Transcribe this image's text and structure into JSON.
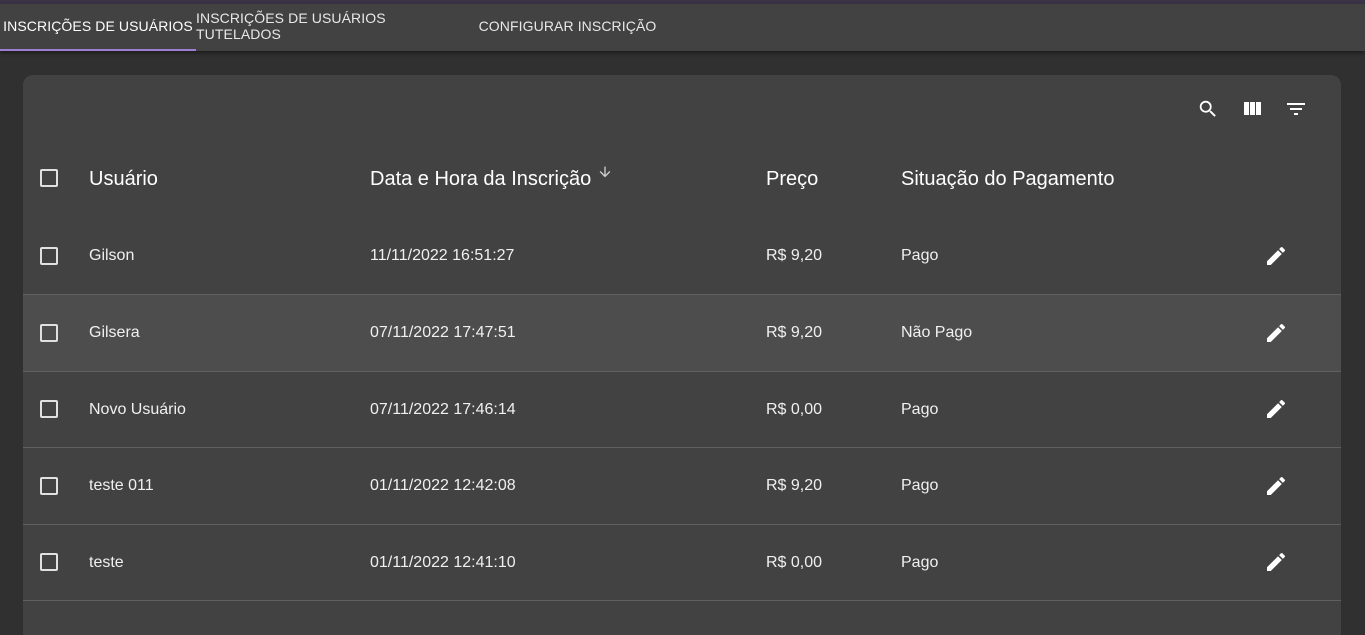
{
  "tabs": [
    {
      "label": "INSCRIÇÕES DE USUÁRIOS",
      "active": true
    },
    {
      "label": "INSCRIÇÕES DE USUÁRIOS TUTELADOS",
      "active": false
    },
    {
      "label": "CONFIGURAR INSCRIÇÃO",
      "active": false
    }
  ],
  "toolbar": {
    "icons": [
      "search-icon",
      "view-column-icon",
      "filter-list-icon"
    ]
  },
  "table": {
    "columns": [
      {
        "label": "Usuário"
      },
      {
        "label": "Data e Hora da Inscrição",
        "sorted": "descending"
      },
      {
        "label": "Preço"
      },
      {
        "label": "Situação do Pagamento"
      }
    ],
    "rows": [
      {
        "usuario": "Gilson",
        "data_hora": "11/11/2022 16:51:27",
        "preco": "R$ 9,20",
        "situacao": "Pago"
      },
      {
        "usuario": "Gilsera",
        "data_hora": "07/11/2022 17:47:51",
        "preco": "R$ 9,20",
        "situacao": "Não Pago"
      },
      {
        "usuario": "Novo Usuário",
        "data_hora": "07/11/2022 17:46:14",
        "preco": "R$ 0,00",
        "situacao": "Pago"
      },
      {
        "usuario": "teste 011",
        "data_hora": "01/11/2022 12:42:08",
        "preco": "R$ 9,20",
        "situacao": "Pago"
      },
      {
        "usuario": "teste",
        "data_hora": "01/11/2022 12:41:10",
        "preco": "R$ 0,00",
        "situacao": "Pago"
      }
    ]
  },
  "colors": {
    "background": "#303030",
    "surface": "#424242",
    "accent": "#9c7fd0",
    "hover_row": "#4d4d4d"
  }
}
